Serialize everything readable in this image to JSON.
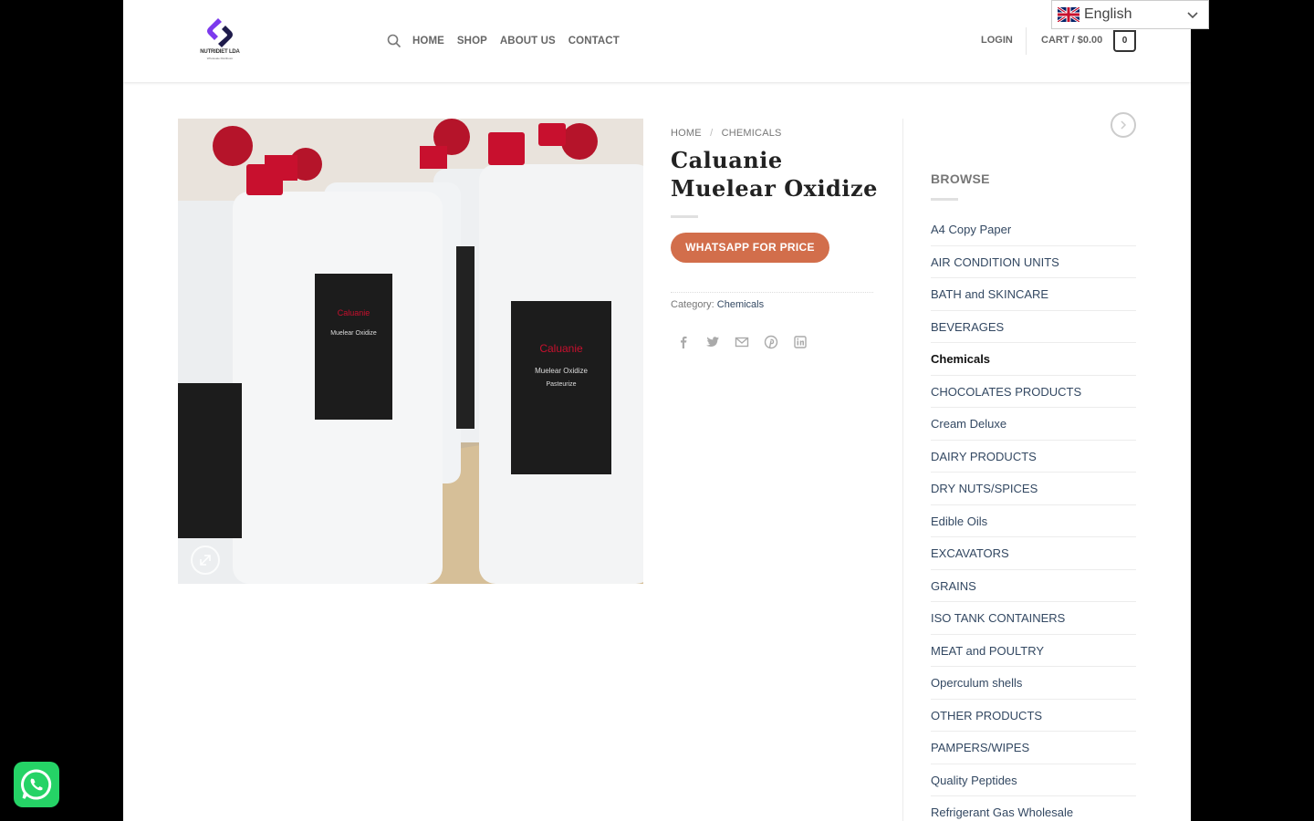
{
  "header": {
    "logo_text": "NUTRIDIET LDA",
    "logo_subtext": "Wholesale Distributor",
    "nav": [
      "HOME",
      "SHOP",
      "ABOUT US",
      "CONTACT"
    ],
    "login": "LOGIN",
    "cart_label": "CART /",
    "cart_price": "$0.00",
    "cart_count": "0"
  },
  "language": {
    "label": "English",
    "flag": "gb-flag-icon"
  },
  "product": {
    "breadcrumb": [
      "HOME",
      "CHEMICALS"
    ],
    "breadcrumb_sep": "/",
    "title": "Caluanie Muelear Oxidize",
    "button": "WHATSAPP FOR PRICE",
    "category_label": "Category:",
    "category_value": "Chemicals",
    "share_icons": [
      "facebook-icon",
      "twitter-icon",
      "email-icon",
      "pinterest-icon",
      "linkedin-icon"
    ],
    "image_label_lines": [
      "Caluanie",
      "Muelear Oxidize",
      "Pasteurize"
    ]
  },
  "sidebar": {
    "title": "BROWSE",
    "items": [
      {
        "label": "A4 Copy Paper",
        "active": false
      },
      {
        "label": "AIR CONDITION UNITS",
        "active": false
      },
      {
        "label": "BATH and SKINCARE",
        "active": false
      },
      {
        "label": "BEVERAGES",
        "active": false
      },
      {
        "label": "Chemicals",
        "active": true
      },
      {
        "label": "CHOCOLATES PRODUCTS",
        "active": false
      },
      {
        "label": "Cream Deluxe",
        "active": false
      },
      {
        "label": "DAIRY PRODUCTS",
        "active": false
      },
      {
        "label": "DRY NUTS/SPICES",
        "active": false
      },
      {
        "label": "Edible Oils",
        "active": false
      },
      {
        "label": "EXCAVATORS",
        "active": false
      },
      {
        "label": "GRAINS",
        "active": false
      },
      {
        "label": "ISO TANK CONTAINERS",
        "active": false
      },
      {
        "label": "MEAT and POULTRY",
        "active": false
      },
      {
        "label": "Operculum shells",
        "active": false
      },
      {
        "label": "OTHER PRODUCTS",
        "active": false
      },
      {
        "label": "PAMPERS/WIPES",
        "active": false
      },
      {
        "label": "Quality Peptides",
        "active": false
      },
      {
        "label": "Refrigerant Gas Wholesale",
        "active": false
      }
    ]
  },
  "colors": {
    "accent": "#d26e4b",
    "link": "#334862",
    "whatsapp": "#25d366"
  }
}
